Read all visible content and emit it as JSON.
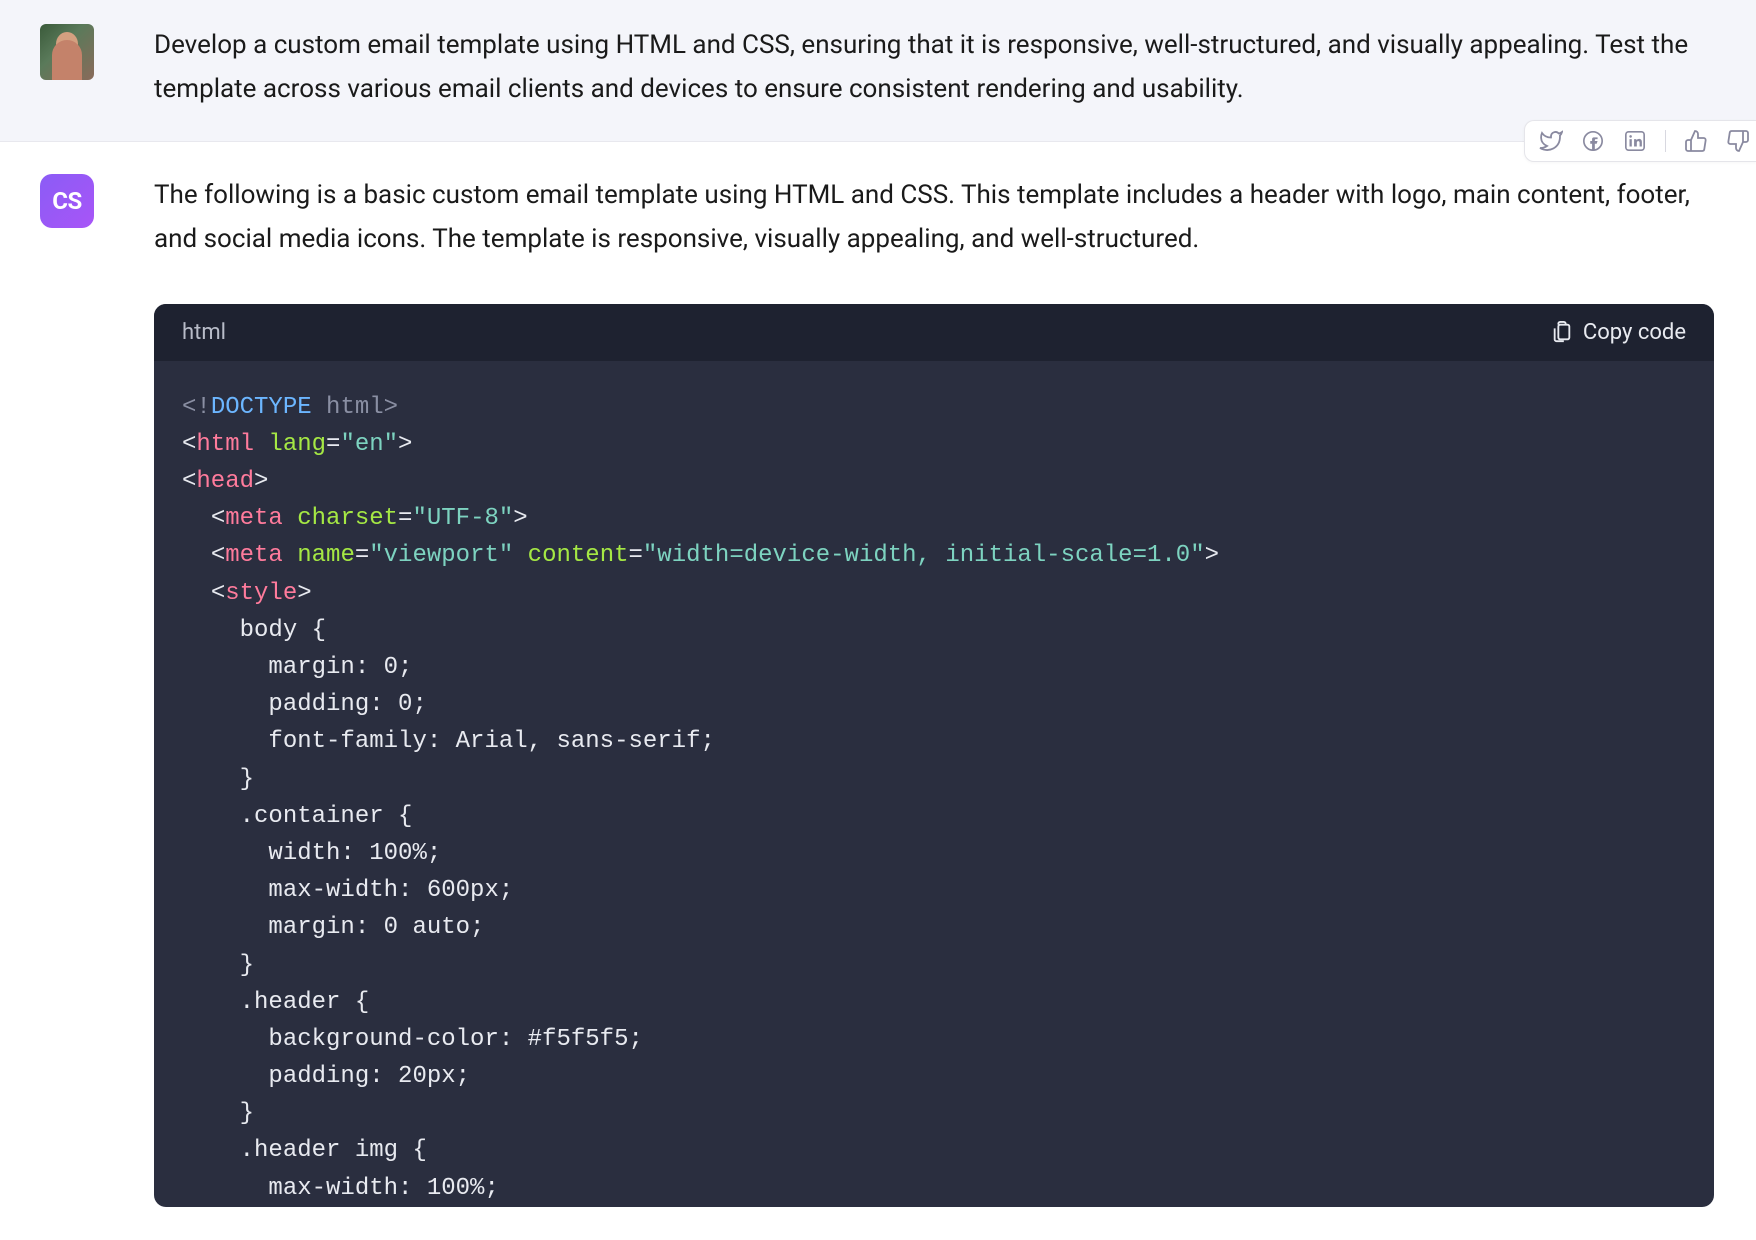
{
  "user": {
    "message": "Develop a custom email template using HTML and CSS, ensuring that it is responsive, well-structured, and visually appealing. Test the template across various email clients and devices to ensure consistent rendering and usability."
  },
  "assistant": {
    "badge": "CS",
    "intro": "The following is a basic custom email template using HTML and CSS. This template includes a header with logo, main content, footer, and social media icons. The template is responsive, visually appealing, and well-structured."
  },
  "code": {
    "language": "html",
    "copy_label": "Copy code",
    "lines": {
      "l1_doctype": "<!",
      "l1_doctype2": "DOCTYPE",
      "l1_html": " html",
      "l1_close": ">",
      "l2_open": "<",
      "l2_tag": "html",
      "l2_attr": " lang",
      "l2_eq": "=",
      "l2_val": "\"en\"",
      "l2_close": ">",
      "l3_open": "<",
      "l3_tag": "head",
      "l3_close": ">",
      "l4_indent": "  ",
      "l4_open": "<",
      "l4_tag": "meta",
      "l4_attr": " charset",
      "l4_eq": "=",
      "l4_val": "\"UTF-8\"",
      "l4_close": ">",
      "l5_indent": "  ",
      "l5_open": "<",
      "l5_tag": "meta",
      "l5_attr1": " name",
      "l5_eq1": "=",
      "l5_val1": "\"viewport\"",
      "l5_attr2": " content",
      "l5_eq2": "=",
      "l5_val2": "\"width=device-width, initial-scale=1.0\"",
      "l5_close": ">",
      "l6_indent": "  ",
      "l6_open": "<",
      "l6_tag": "style",
      "l6_close": ">",
      "l7": "    body {",
      "l8": "      margin: 0;",
      "l9": "      padding: 0;",
      "l10": "      font-family: Arial, sans-serif;",
      "l11": "    }",
      "l12": "    .container {",
      "l13": "      width: 100%;",
      "l14": "      max-width: 600px;",
      "l15": "      margin: 0 auto;",
      "l16": "    }",
      "l17": "    .header {",
      "l18": "      background-color: #f5f5f5;",
      "l19": "      padding: 20px;",
      "l20": "    }",
      "l21": "    .header img {",
      "l22": "      max-width: 100%;"
    }
  },
  "toolbar": {
    "twitter": "twitter",
    "facebook": "facebook",
    "linkedin": "linkedin",
    "thumbs_up": "thumbs-up",
    "thumbs_down": "thumbs-down"
  }
}
